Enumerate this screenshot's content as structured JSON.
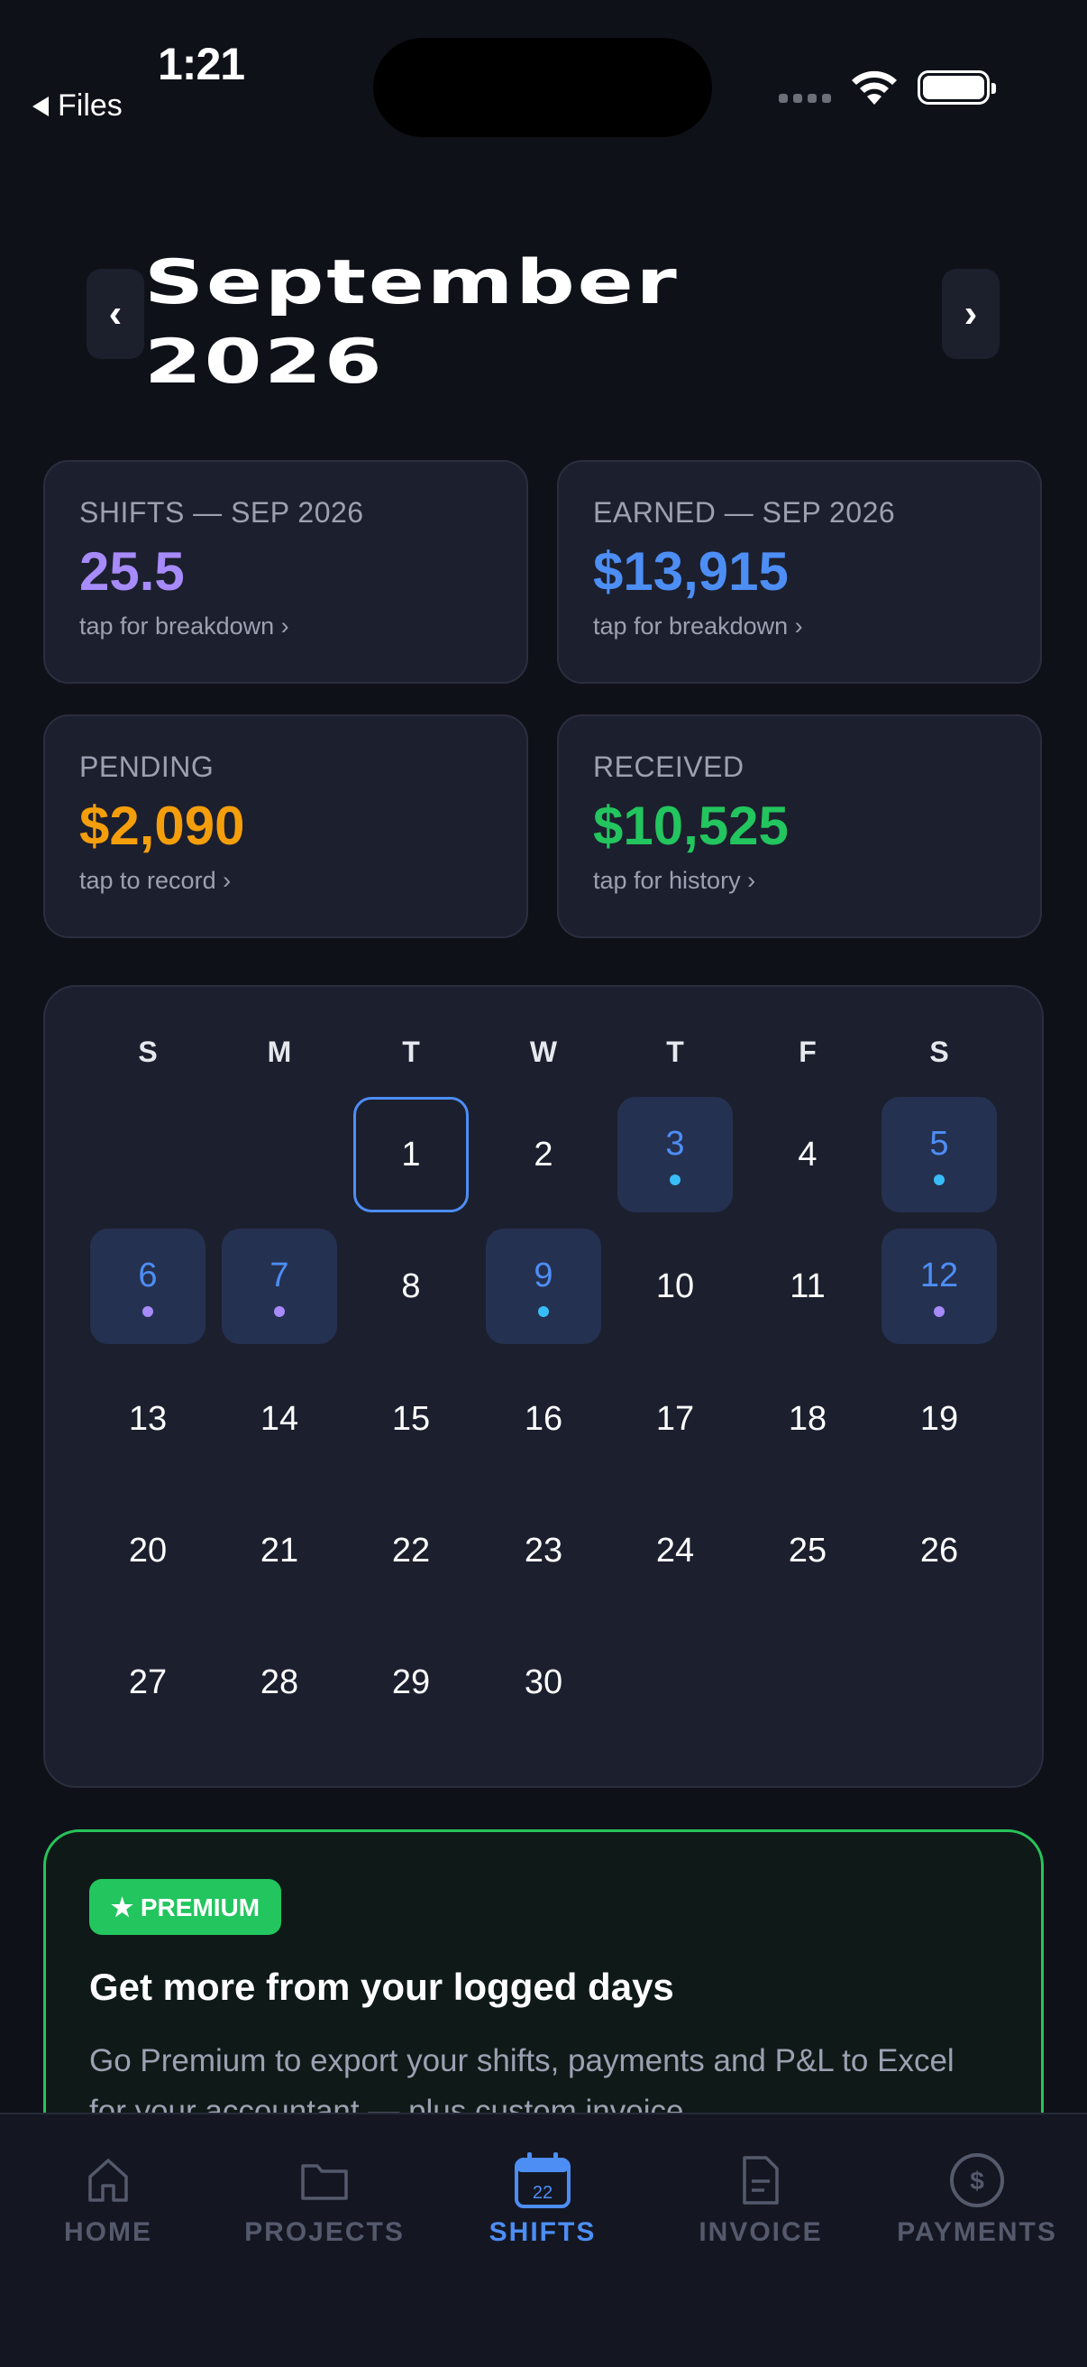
{
  "status_bar": {
    "time": "1:21",
    "back_label": "Files"
  },
  "header": {
    "month_line1": "September",
    "month_line2": "2026",
    "prev_icon": "‹",
    "next_icon": "›"
  },
  "stats": [
    {
      "label": "SHIFTS — SEP 2026",
      "value": "25.5",
      "hint": "tap for breakdown ›",
      "color": "#a78bfa"
    },
    {
      "label": "EARNED — SEP 2026",
      "value": "$13,915",
      "hint": "tap for breakdown ›",
      "color": "#4d8ef5"
    },
    {
      "label": "PENDING",
      "value": "$2,090",
      "hint": "tap to record ›",
      "color": "#f59e0b"
    },
    {
      "label": "RECEIVED",
      "value": "$10,525",
      "hint": "tap for history ›",
      "color": "#22c55e"
    }
  ],
  "calendar": {
    "weekdays": [
      "S",
      "M",
      "T",
      "W",
      "T",
      "F",
      "S"
    ],
    "days": [
      {
        "n": "1",
        "col": 2,
        "row": 0,
        "today": true
      },
      {
        "n": "2",
        "col": 3,
        "row": 0
      },
      {
        "n": "3",
        "col": 4,
        "row": 0,
        "shift": true,
        "dot": "#38bdf8"
      },
      {
        "n": "4",
        "col": 5,
        "row": 0
      },
      {
        "n": "5",
        "col": 6,
        "row": 0,
        "shift": true,
        "dot": "#38bdf8"
      },
      {
        "n": "6",
        "col": 0,
        "row": 1,
        "shift": true,
        "dot": "#a78bfa"
      },
      {
        "n": "7",
        "col": 1,
        "row": 1,
        "shift": true,
        "dot": "#a78bfa"
      },
      {
        "n": "8",
        "col": 2,
        "row": 1
      },
      {
        "n": "9",
        "col": 3,
        "row": 1,
        "shift": true,
        "dot": "#38bdf8"
      },
      {
        "n": "10",
        "col": 4,
        "row": 1
      },
      {
        "n": "11",
        "col": 5,
        "row": 1
      },
      {
        "n": "12",
        "col": 6,
        "row": 1,
        "shift": true,
        "dot": "#a78bfa"
      },
      {
        "n": "13",
        "col": 0,
        "row": 2
      },
      {
        "n": "14",
        "col": 1,
        "row": 2
      },
      {
        "n": "15",
        "col": 2,
        "row": 2
      },
      {
        "n": "16",
        "col": 3,
        "row": 2
      },
      {
        "n": "17",
        "col": 4,
        "row": 2
      },
      {
        "n": "18",
        "col": 5,
        "row": 2
      },
      {
        "n": "19",
        "col": 6,
        "row": 2
      },
      {
        "n": "20",
        "col": 0,
        "row": 3
      },
      {
        "n": "21",
        "col": 1,
        "row": 3
      },
      {
        "n": "22",
        "col": 2,
        "row": 3
      },
      {
        "n": "23",
        "col": 3,
        "row": 3
      },
      {
        "n": "24",
        "col": 4,
        "row": 3
      },
      {
        "n": "25",
        "col": 5,
        "row": 3
      },
      {
        "n": "26",
        "col": 6,
        "row": 3
      },
      {
        "n": "27",
        "col": 0,
        "row": 4
      },
      {
        "n": "28",
        "col": 1,
        "row": 4
      },
      {
        "n": "29",
        "col": 2,
        "row": 4
      },
      {
        "n": "30",
        "col": 3,
        "row": 4
      }
    ]
  },
  "premium": {
    "badge": "★ PREMIUM",
    "title": "Get more from your logged days",
    "body": "Go Premium to export your shifts, payments and P&L to Excel for your accountant — plus custom invoice"
  },
  "tabs": [
    {
      "label": "HOME",
      "icon": "home-icon",
      "active": false
    },
    {
      "label": "PROJECTS",
      "icon": "folder-icon",
      "active": false
    },
    {
      "label": "SHIFTS",
      "icon": "calendar-icon",
      "active": true,
      "icon_text": "22"
    },
    {
      "label": "INVOICE",
      "icon": "document-icon",
      "active": false
    },
    {
      "label": "PAYMENTS",
      "icon": "dollar-circle-icon",
      "active": false,
      "icon_text": "$"
    }
  ],
  "colors": {
    "background": "#0f1118",
    "card": "#1c1f2e",
    "accent": "#4d8ef5",
    "premium_green": "#22c55e"
  }
}
